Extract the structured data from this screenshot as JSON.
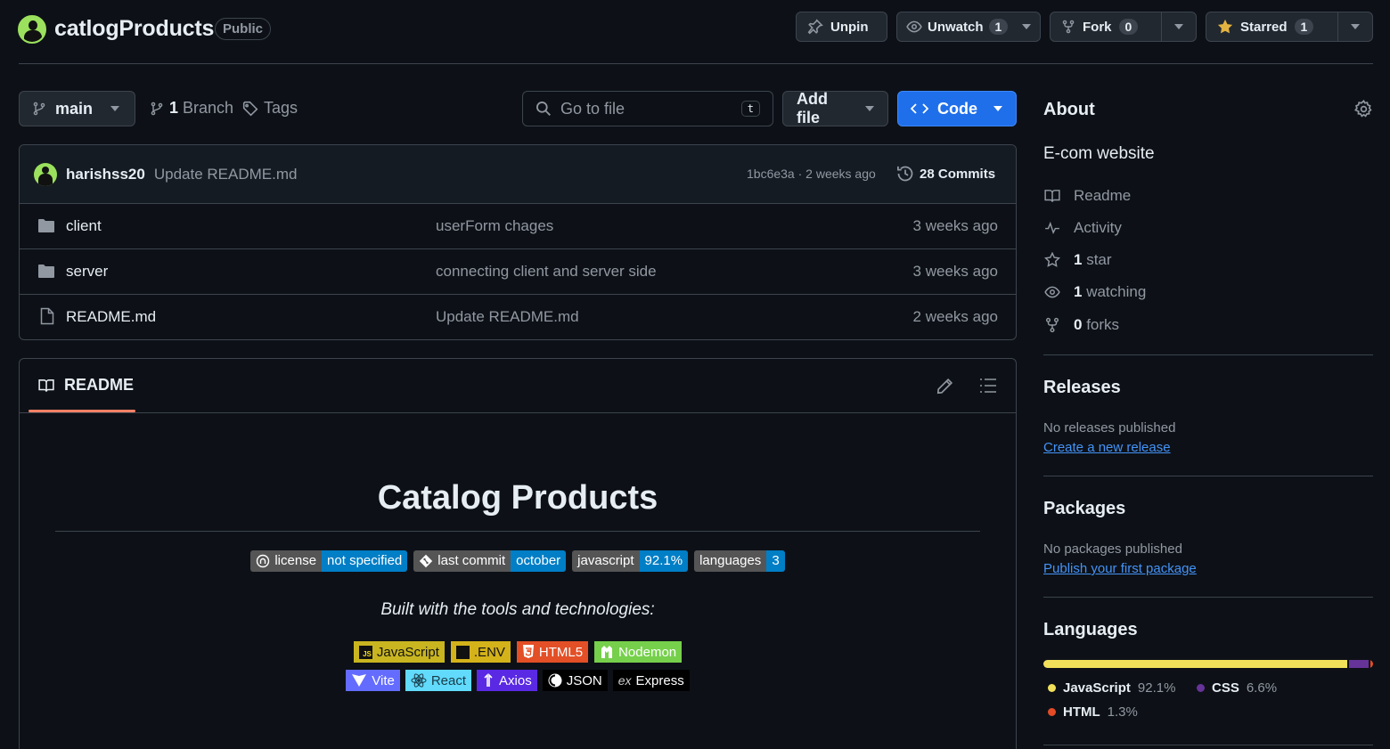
{
  "repo": {
    "name": "catlogProducts",
    "visibility": "Public"
  },
  "header_buttons": {
    "unpin": "Unpin",
    "unwatch": "Unwatch",
    "watch_count": "1",
    "fork": "Fork",
    "fork_count": "0",
    "starred": "Starred",
    "star_count": "1"
  },
  "toolbar": {
    "branch": "main",
    "branch_count": "1",
    "branch_label": "Branch",
    "tags_label": "Tags",
    "search_placeholder": "Go to file",
    "search_kbd": "t",
    "add_file": "Add file",
    "code": "Code"
  },
  "latest_commit": {
    "user": "harishss20",
    "message": "Update README.md",
    "meta": "1bc6e3a · 2 weeks ago",
    "commits_count": "28",
    "commits_label": "Commits"
  },
  "files": [
    {
      "name": "client",
      "type": "folder",
      "message": "userForm chages",
      "time": "3 weeks ago"
    },
    {
      "name": "server",
      "type": "folder",
      "message": "connecting client and server side",
      "time": "3 weeks ago"
    },
    {
      "name": "README.md",
      "type": "file",
      "message": "Update README.md",
      "time": "2 weeks ago"
    }
  ],
  "readme": {
    "tab_label": "README",
    "title": "Catalog Products",
    "shields": [
      {
        "label": "license",
        "value": "not specified"
      },
      {
        "label": "last commit",
        "value": "october"
      },
      {
        "label": "javascript",
        "value": "92.1%"
      },
      {
        "label": "languages",
        "value": "3"
      }
    ],
    "built_with": "Built with the tools and technologies:",
    "tech_row1": [
      {
        "name": "JavaScript",
        "color": "#c9b520",
        "text": "#111111"
      },
      {
        "name": ".ENV",
        "color": "#d4b21a",
        "text": "#111111"
      },
      {
        "name": "HTML5",
        "color": "#e34f26",
        "text": "#ffffff"
      },
      {
        "name": "Nodemon",
        "color": "#76d04b",
        "text": "#ffffff"
      }
    ],
    "tech_row2": [
      {
        "name": "Vite",
        "color": "#646cff",
        "text": "#ffffff"
      },
      {
        "name": "React",
        "color": "#61dafb",
        "text": "#1a3b4a"
      },
      {
        "name": "Axios",
        "color": "#5a29e4",
        "text": "#ffffff"
      },
      {
        "name": "JSON",
        "color": "#000000",
        "text": "#ffffff"
      },
      {
        "name": "Express",
        "color": "#000000",
        "text": "#ffffff"
      }
    ]
  },
  "about": {
    "heading": "About",
    "description": "E-com website",
    "items": [
      {
        "icon": "book-icon",
        "bold": "",
        "label": "Readme"
      },
      {
        "icon": "pulse-icon",
        "bold": "",
        "label": "Activity"
      },
      {
        "icon": "star-icon",
        "bold": "1",
        "label": "star"
      },
      {
        "icon": "eye-icon",
        "bold": "1",
        "label": "watching"
      },
      {
        "icon": "fork-icon",
        "bold": "0",
        "label": "forks"
      }
    ]
  },
  "releases": {
    "heading": "Releases",
    "empty": "No releases published",
    "link": "Create a new release"
  },
  "packages": {
    "heading": "Packages",
    "empty": "No packages published",
    "link": "Publish your first package"
  },
  "languages": {
    "heading": "Languages",
    "list": [
      {
        "name": "JavaScript",
        "percent": "92.1%",
        "value": 92.1,
        "color": "#f1e05a"
      },
      {
        "name": "CSS",
        "percent": "6.6%",
        "value": 6.6,
        "color": "#663399"
      },
      {
        "name": "HTML",
        "percent": "1.3%",
        "value": 1.3,
        "color": "#e34c26"
      }
    ]
  }
}
